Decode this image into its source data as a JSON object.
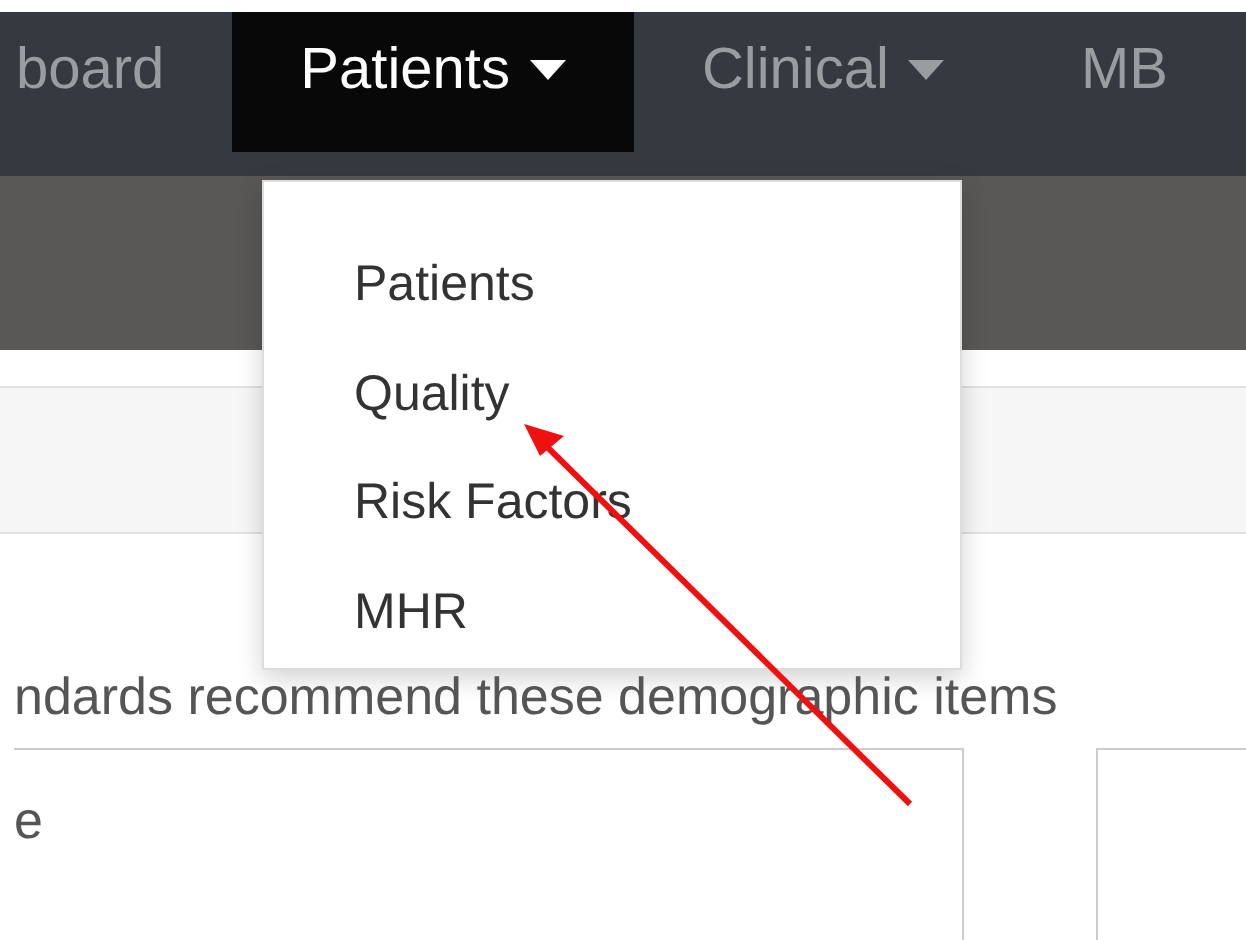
{
  "navbar": {
    "items": [
      {
        "label": "board",
        "selected": false,
        "dropdown": false
      },
      {
        "label": "Patients",
        "selected": true,
        "dropdown": true
      },
      {
        "label": "Clinical",
        "selected": false,
        "dropdown": true
      },
      {
        "label": "MB",
        "selected": false,
        "dropdown": false
      }
    ]
  },
  "dropdown_menu": {
    "items": [
      {
        "label": "Patients"
      },
      {
        "label": "Quality"
      },
      {
        "label": "Risk Factors"
      },
      {
        "label": "MHR"
      }
    ]
  },
  "content": {
    "paragraph": "ndards recommend these demographic items",
    "cards": [
      {
        "text": "e"
      }
    ]
  }
}
